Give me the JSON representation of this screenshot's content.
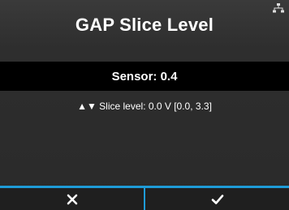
{
  "header": {
    "title": "GAP Slice Level",
    "status_icon": "network-icon"
  },
  "sensor": {
    "label": "Sensor: 0.4"
  },
  "slice": {
    "arrows": "▲▼",
    "text": "Slice level: 0.0 V [0.0, 3.3]"
  },
  "footer": {
    "cancel_icon": "close-icon",
    "confirm_icon": "check-icon",
    "accent": "#1e9bd7"
  }
}
